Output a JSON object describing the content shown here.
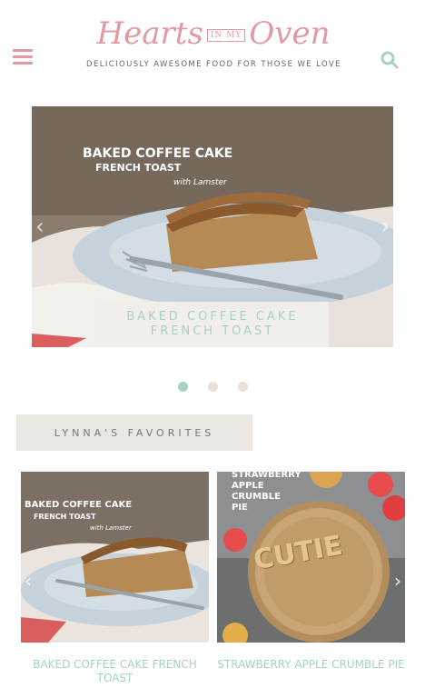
{
  "header": {
    "logo_left": "Hearts",
    "logo_mid": "IN MY",
    "logo_right": "Oven",
    "tagline": "DELICIOUSLY AWESOME FOOD FOR THOSE WE LOVE",
    "menu_icon": "hamburger-icon",
    "search_icon": "search-icon"
  },
  "hero": {
    "overlay_line1": "BAKED COFFEE CAKE",
    "overlay_line2": "FRENCH TOAST",
    "overlay_sub": "with Lamster",
    "caption_line1": "BAKED COFFEE CAKE",
    "caption_line2": "FRENCH TOAST",
    "prev_icon": "chevron-left-icon",
    "next_icon": "chevron-right-icon"
  },
  "slider": {
    "total": 3,
    "active": 1
  },
  "favorites": {
    "heading": "LYNNA'S FAVORITES",
    "items": [
      {
        "overlay_line1": "BAKED COFFEE CAKE",
        "overlay_line2": "FRENCH TOAST",
        "overlay_sub": "with Lamster",
        "title": "BAKED COFFEE CAKE FRENCH TOAST"
      },
      {
        "overlay_line1": "STRAWBERRY",
        "overlay_line2": "APPLE",
        "overlay_line3": "CRUMBLE",
        "overlay_line4": "PIE",
        "crust_text": "CUTIE",
        "title": "STRAWBERRY APPLE CRUMBLE PIE"
      }
    ]
  },
  "colors": {
    "brand_pink": "#e29aa2",
    "accent_mint": "#a7d2c3",
    "banner_bg": "#ebe7e2"
  }
}
